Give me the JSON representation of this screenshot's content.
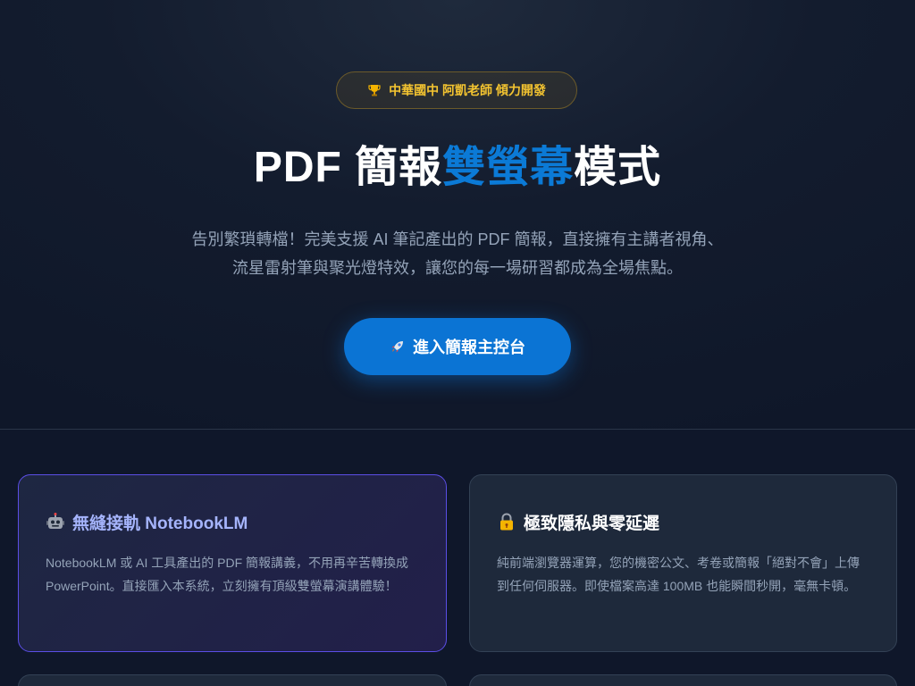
{
  "hero": {
    "badge": {
      "icon": "trophy-icon",
      "text": "中華國中 阿凱老師 傾力開發"
    },
    "title": {
      "part1": "PDF 簡報",
      "accent": "雙螢幕",
      "part2": "模式"
    },
    "subtitle": {
      "line1": "告別繁瑣轉檔！完美支援 AI 筆記產出的 PDF 簡報，直接擁有主講者視角、",
      "line2": "流星雷射筆與聚光燈特效，讓您的每一場研習都成為全場焦點。"
    },
    "cta": {
      "icon": "rocket-icon",
      "label": "進入簡報主控台"
    }
  },
  "features": [
    {
      "icon": "robot-icon",
      "title": "無縫接軌 NotebookLM",
      "body": "NotebookLM 或 AI 工具產出的 PDF 簡報講義，不用再辛苦轉換成 PowerPoint。直接匯入本系統，立刻擁有頂級雙螢幕演講體驗！"
    },
    {
      "icon": "lock-icon",
      "title": "極致隱私與零延遲",
      "body": "純前端瀏覽器運算，您的機密公文、考卷或簡報「絕對不會」上傳到任何伺服器。即使檔案高達 100MB 也能瞬間秒開，毫無卡頓。"
    }
  ],
  "colors": {
    "accent": "#0b7ad6",
    "badge_text": "#f4c430",
    "cta_bg": "#0b74d4",
    "highlight_border": "#5b4ee6",
    "highlight_title": "#a5b4fc"
  }
}
